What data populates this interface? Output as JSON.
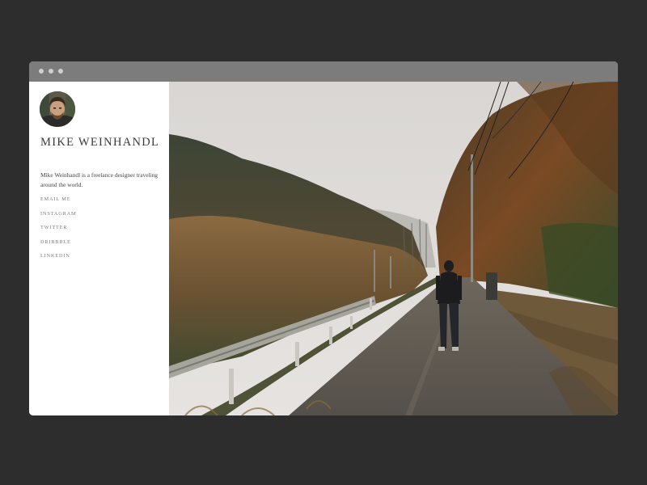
{
  "profile": {
    "name": "MIKE WEINHANDL",
    "bio": "Mike Weinhandl is a freelance designer traveling around the world."
  },
  "nav": {
    "links": [
      {
        "label": "EMAIL ME"
      },
      {
        "label": "INSTAGRAM"
      },
      {
        "label": "TWITTER"
      },
      {
        "label": "DRIBBBLE"
      },
      {
        "label": "LINKEDIN"
      }
    ]
  },
  "colors": {
    "background": "#2d2d2d",
    "titlebar": "#7c7c7c",
    "sidebar": "#ffffff",
    "text": "#3a3a3a",
    "link": "#7a7a7a"
  }
}
